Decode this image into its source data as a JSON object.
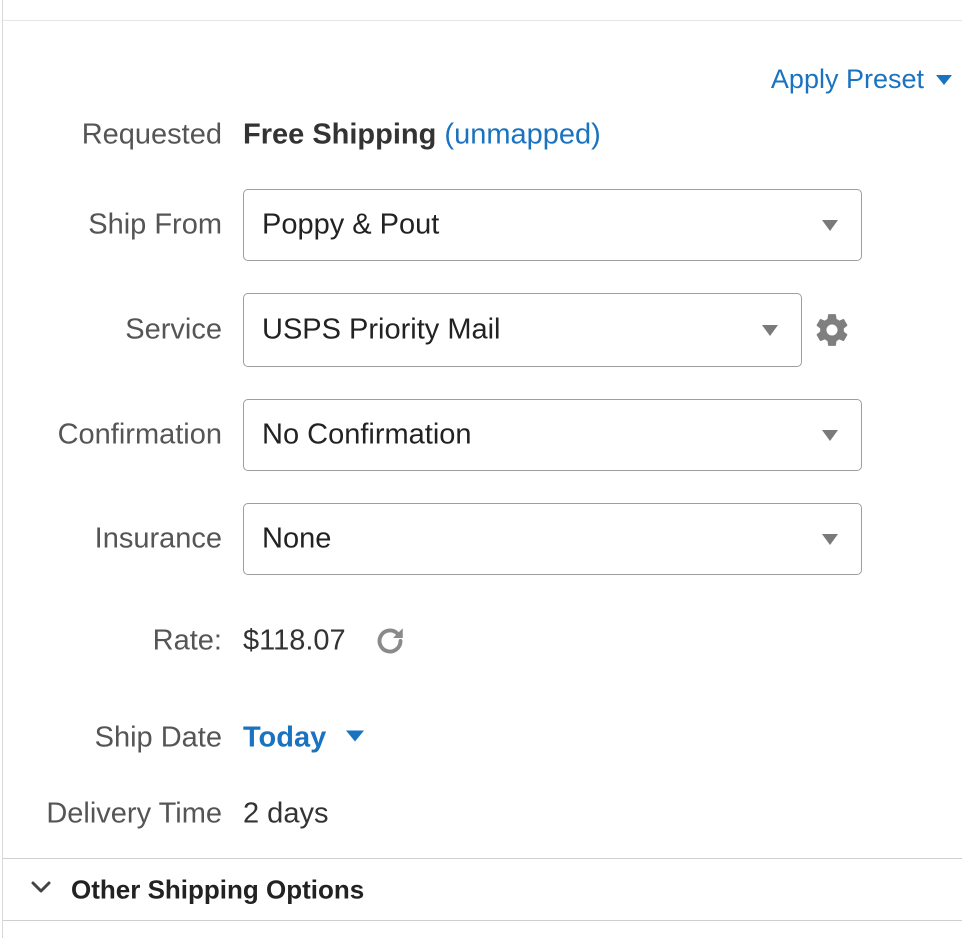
{
  "apply_preset": {
    "label": "Apply Preset",
    "icon": "caret-down-icon"
  },
  "requested": {
    "label": "Requested",
    "value": "Free Shipping",
    "mapping": "(unmapped)"
  },
  "ship_from": {
    "label": "Ship From",
    "value": "Poppy & Pout"
  },
  "service": {
    "label": "Service",
    "value": "USPS Priority Mail",
    "settings_icon": "gear-icon"
  },
  "confirmation": {
    "label": "Confirmation",
    "value": "No Confirmation"
  },
  "insurance": {
    "label": "Insurance",
    "value": "None"
  },
  "rate": {
    "label": "Rate:",
    "value": "$118.07",
    "refresh_icon": "refresh-icon"
  },
  "ship_date": {
    "label": "Ship Date",
    "value": "Today"
  },
  "delivery_time": {
    "label": "Delivery Time",
    "value": "2 days"
  },
  "other_shipping_options": {
    "label": "Other Shipping Options",
    "icon": "chevron-down-icon"
  },
  "colors": {
    "link": "#1a73c0",
    "label": "#555555",
    "text": "#333333",
    "border": "#9e9e9e"
  }
}
